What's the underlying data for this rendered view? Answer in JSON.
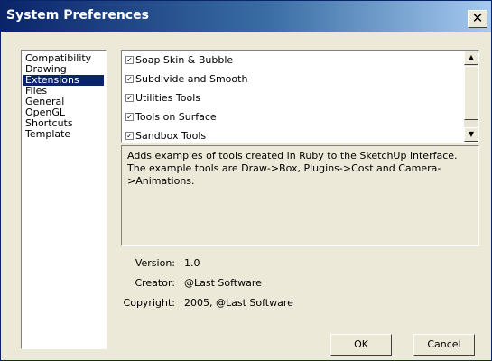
{
  "window": {
    "title": "System Preferences",
    "close_label": "✕"
  },
  "categories": {
    "items": [
      "Compatibility",
      "Drawing",
      "Extensions",
      "Files",
      "General",
      "OpenGL",
      "Shortcuts",
      "Template"
    ],
    "selected": "Extensions"
  },
  "extensions": {
    "items": [
      {
        "label": "Soap Skin & Bubble",
        "checked": true
      },
      {
        "label": "Subdivide and Smooth",
        "checked": true
      },
      {
        "label": "Utilities Tools",
        "checked": true
      },
      {
        "label": "Tools on Surface",
        "checked": true
      },
      {
        "label": "Sandbox Tools",
        "checked": true
      }
    ],
    "check_glyph": "✓"
  },
  "description": "Adds examples of tools created in Ruby to the SketchUp interface. The example tools are Draw->Box, Plugins->Cost and Camera->Animations.",
  "details": {
    "version_label": "Version:",
    "version": "1.0",
    "creator_label": "Creator:",
    "creator": "@Last Software",
    "copyright_label": "Copyright:",
    "copyright": "2005, @Last Software"
  },
  "buttons": {
    "ok": "OK",
    "cancel": "Cancel"
  },
  "colors": {
    "titlebar_start": "#0a246a",
    "titlebar_end": "#a6caf0",
    "selection": "#0a246a",
    "dialog_bg": "#ece9d8"
  }
}
